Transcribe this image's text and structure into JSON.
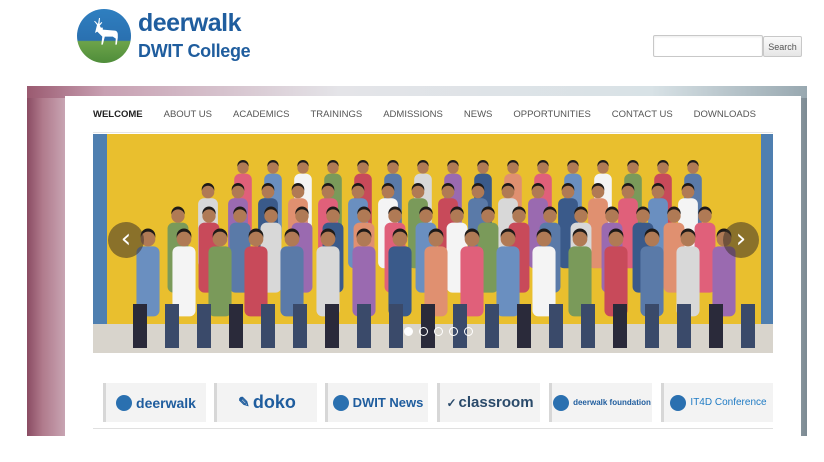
{
  "header": {
    "brand_name": "deerwalk",
    "brand_sub": "DWIT College",
    "logo_icon": "deer-logo-icon"
  },
  "search": {
    "placeholder": "",
    "button_label": "Search"
  },
  "nav": {
    "items": [
      {
        "label": "WELCOME",
        "active": true
      },
      {
        "label": "ABOUT US",
        "active": false
      },
      {
        "label": "ACADEMICS",
        "active": false
      },
      {
        "label": "TRAININGS",
        "active": false
      },
      {
        "label": "ADMISSIONS",
        "active": false
      },
      {
        "label": "NEWS",
        "active": false
      },
      {
        "label": "OPPORTUNITIES",
        "active": false
      },
      {
        "label": "CONTACT US",
        "active": false
      },
      {
        "label": "DOWNLOADS",
        "active": false
      }
    ]
  },
  "slider": {
    "prev_glyph": "‹",
    "next_glyph": "›",
    "slide_count": 5,
    "active_slide": 1,
    "photo_description_icon": "group-photo-image"
  },
  "partners": [
    {
      "label": "deerwalk",
      "icon": "deer-icon"
    },
    {
      "label": "doko",
      "icon": "pen-icon"
    },
    {
      "label": "DWIT News",
      "icon": "deer-icon"
    },
    {
      "label": "classroom",
      "icon": "compass-icon"
    },
    {
      "label": "deerwalk foundation",
      "icon": "deer-icon"
    },
    {
      "label": "IT4D Conference",
      "icon": "gear-icon"
    }
  ],
  "colors": {
    "brand": "#1f5d9e",
    "slide_background": "#e8c030",
    "nav_active": "#222222"
  }
}
